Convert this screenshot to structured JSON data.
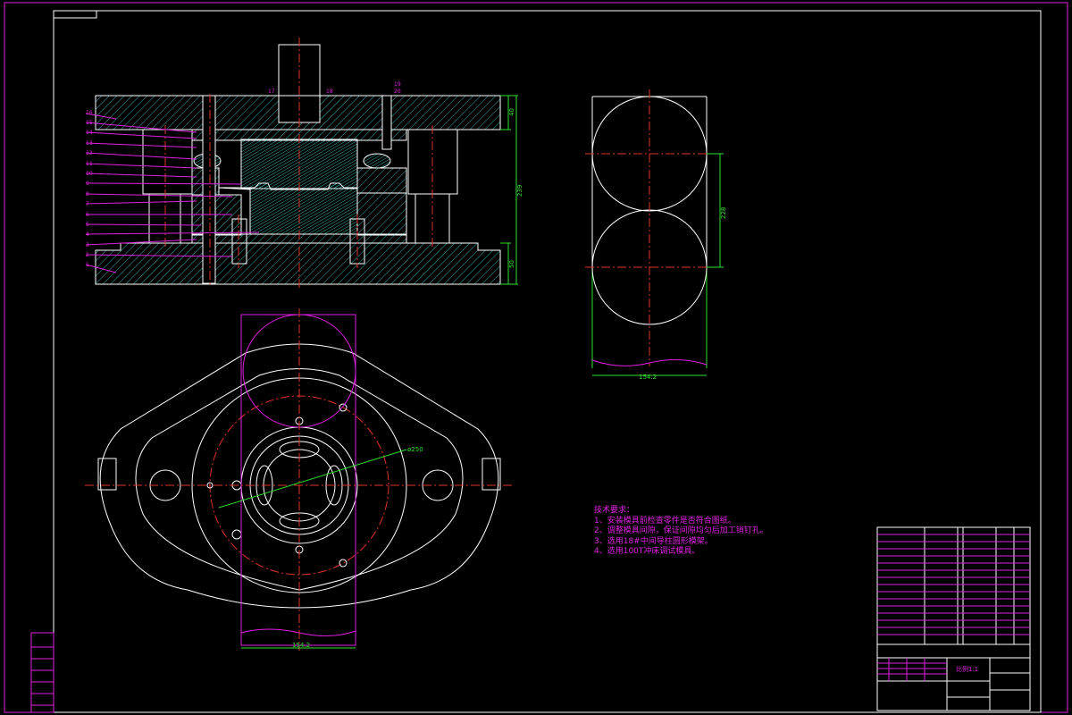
{
  "section_view": {
    "part_labels_left": [
      "16",
      "15",
      "14",
      "13",
      "12",
      "11",
      "10",
      "9",
      "8",
      "7",
      "6",
      "5",
      "4",
      "3",
      "2",
      "1"
    ],
    "part_labels_top": [
      "17",
      "18",
      "19",
      "20"
    ],
    "dimensions": {
      "top_plate": "40",
      "bottom_plate": "50",
      "closed_height": "239"
    }
  },
  "side_view": {
    "dimensions": {
      "pitch": "228",
      "width": "154.2"
    }
  },
  "plan_view": {
    "dimensions": {
      "diameter": "ø250",
      "width": "154.2"
    }
  },
  "technical_requirements": {
    "title": "技术要求：",
    "items": [
      "1、安装模具前检查零件是否符合图纸。",
      "2、调整模具间隙，保证间隙均匀后加工销钉孔。",
      "3、选用18#中间导柱圆形模架。",
      "4、选用100T冲床调试模具。"
    ]
  },
  "title_block": {
    "scale": "比例1:1"
  },
  "colors": {
    "background": "#000000",
    "outline": "#ffffff",
    "centerline": "#e0332a",
    "dimension": "#2fe02f",
    "annotation": "#e020e0",
    "hatch": "#3fd8d8"
  }
}
